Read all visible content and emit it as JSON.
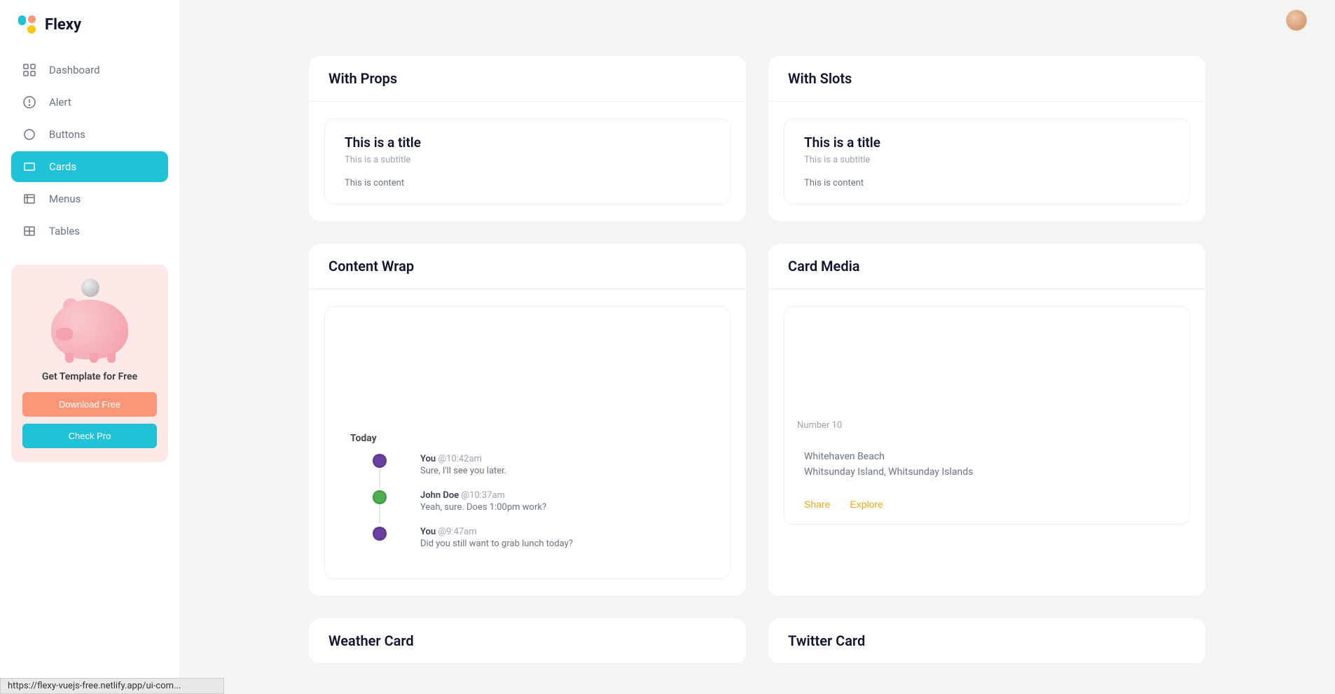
{
  "brand": "Flexy",
  "sidebar": {
    "items": [
      {
        "label": "Dashboard"
      },
      {
        "label": "Alert"
      },
      {
        "label": "Buttons"
      },
      {
        "label": "Cards"
      },
      {
        "label": "Menus"
      },
      {
        "label": "Tables"
      }
    ],
    "promo": {
      "text": "Get Template for Free",
      "download": "Download Free",
      "check": "Check Pro"
    }
  },
  "panels": {
    "withProps": {
      "header": "With Props",
      "title": "This is a title",
      "subtitle": "This is a subtitle",
      "content": "This is content"
    },
    "withSlots": {
      "header": "With Slots",
      "title": "This is a title",
      "subtitle": "This is a subtitle",
      "content": "This is content"
    },
    "contentWrap": {
      "header": "Content Wrap",
      "today": "Today",
      "timeline": [
        {
          "name": "You",
          "time": "@10:42am",
          "msg": "Sure, I'll see you later."
        },
        {
          "name": "John Doe",
          "time": "@10:37am",
          "msg": "Yeah, sure. Does 1:00pm work?"
        },
        {
          "name": "You",
          "time": "@9:47am",
          "msg": "Did you still want to grab lunch today?"
        }
      ]
    },
    "cardMedia": {
      "header": "Card Media",
      "number": "Number 10",
      "location1": "Whitehaven Beach",
      "location2": "Whitsunday Island, Whitsunday Islands",
      "share": "Share",
      "explore": "Explore"
    },
    "weather": {
      "header": "Weather Card"
    },
    "twitter": {
      "header": "Twitter Card"
    }
  },
  "statusBar": "https://flexy-vuejs-free.netlify.app/ui-com..."
}
